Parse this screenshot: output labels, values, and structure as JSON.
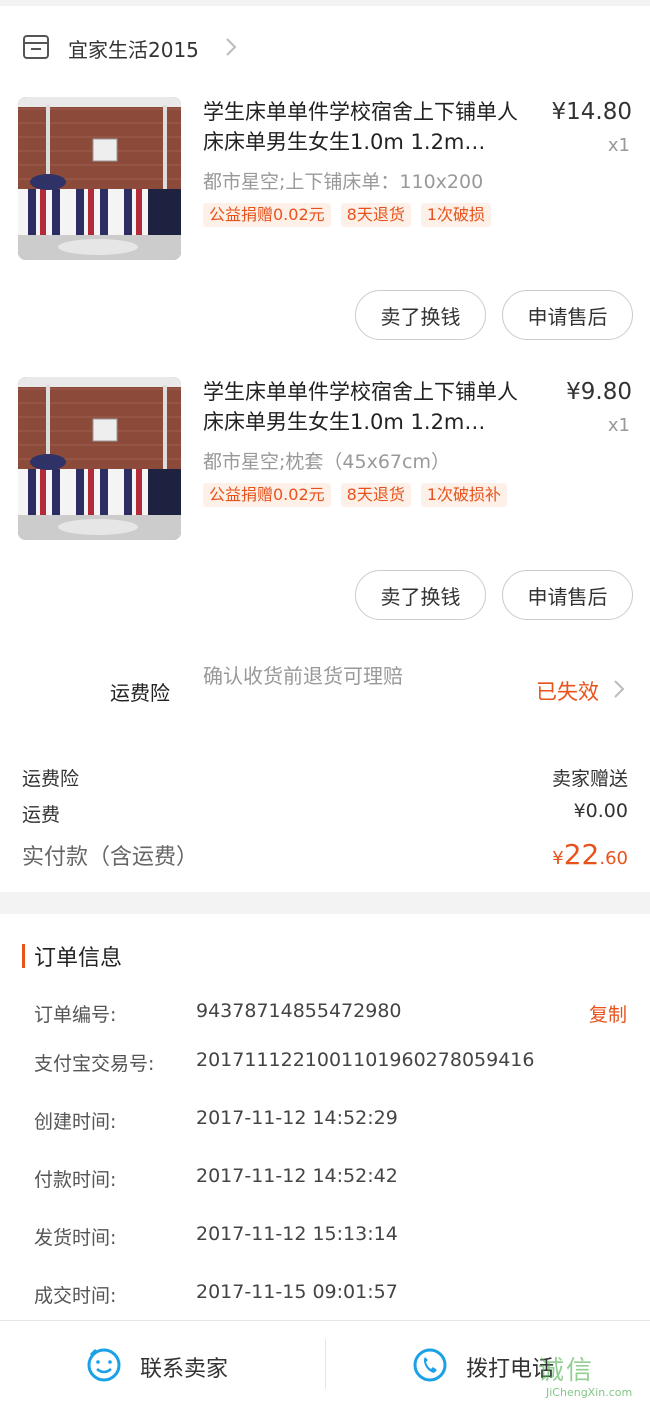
{
  "shop": {
    "name": "宜家生活2015"
  },
  "items": [
    {
      "title": "学生床单单件学校宿舍上下铺单人床床单男生女生1.0m 1.2m…",
      "price": "¥14.80",
      "qty": "x1",
      "spec": "都市星空;上下铺床单：110x200",
      "tags": [
        "公益捐赠0.02元",
        "8天退货",
        "1次破损"
      ],
      "btn_sell": "卖了换钱",
      "btn_after": "申请售后"
    },
    {
      "title": "学生床单单件学校宿舍上下铺单人床床单男生女生1.0m 1.2m…",
      "price": "¥9.80",
      "qty": "x1",
      "spec": "都市星空;枕套（45x67cm）",
      "tags": [
        "公益捐赠0.02元",
        "8天退货",
        "1次破损补"
      ],
      "btn_sell": "卖了换钱",
      "btn_after": "申请售后"
    }
  ],
  "insurance": {
    "label": "运费险",
    "desc": "确认收货前退货可理赔",
    "status": "已失效"
  },
  "summary": {
    "ins_label": "运费险",
    "ins_value": "卖家赠送",
    "ship_label": "运费",
    "ship_value": "¥0.00",
    "total_label": "实付款（含运费）",
    "total_currency": "¥",
    "total_int": "22",
    "total_dec": ".60"
  },
  "order_info": {
    "title": "订单信息",
    "copy_label": "复制",
    "rows": [
      {
        "k": "订单编号:",
        "v": "94378714855472980"
      },
      {
        "k": "支付宝交易号:",
        "v": "2017111221001101960278059416"
      },
      {
        "k": "创建时间:",
        "v": "2017-11-12 14:52:29"
      },
      {
        "k": "付款时间:",
        "v": "2017-11-12 14:52:42"
      },
      {
        "k": "发货时间:",
        "v": "2017-11-12 15:13:14"
      },
      {
        "k": "成交时间:",
        "v": "2017-11-15 09:01:57"
      }
    ]
  },
  "bottom": {
    "contact": "联系卖家",
    "call": "拨打电话"
  },
  "watermark": {
    "text": "诚信",
    "url": "JiChengXin.com"
  },
  "colors": {
    "accent": "#e8531c",
    "icon_blue": "#1aa1e6"
  }
}
